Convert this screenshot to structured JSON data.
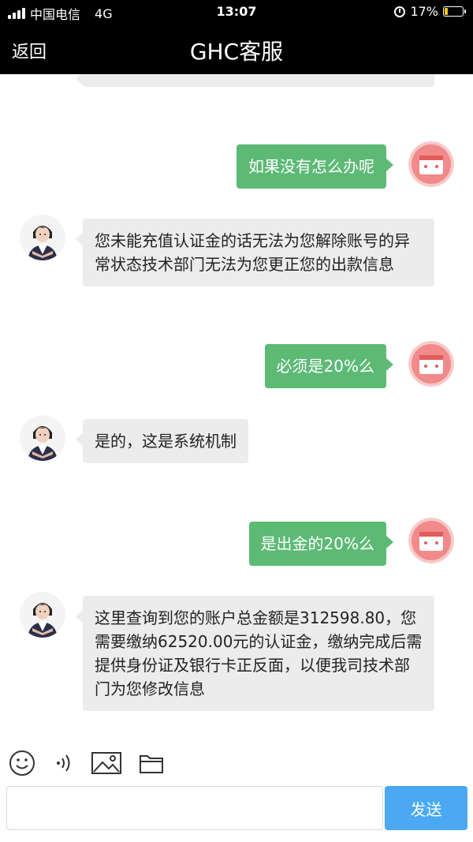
{
  "status_bar": {
    "carrier": "中国电信",
    "network": "4G",
    "time": "13:07",
    "battery": "17%",
    "battery_level": 0.17
  },
  "header": {
    "back_label": "返回",
    "title": "GHC客服"
  },
  "messages": [
    {
      "sender": "user",
      "text": "如果没有怎么办呢"
    },
    {
      "sender": "agent",
      "text": "您未能充值认证金的话无法为您解除账号的异常状态技术部门无法为您更正您的出款信息"
    },
    {
      "sender": "user",
      "text": "必须是20%么"
    },
    {
      "sender": "agent",
      "text": "是的，这是系统机制"
    },
    {
      "sender": "user",
      "text": "是出金的20%么"
    },
    {
      "sender": "agent",
      "text": "这里查询到您的账户总金额是312598.80，您需要缴纳62520.00元的认证金，缴纳完成后需提供身份证及银行卡正反面，以便我司技术部门为您修改信息"
    }
  ],
  "toolbar": {
    "icons": [
      "emoji-icon",
      "voice-icon",
      "image-icon",
      "folder-icon"
    ]
  },
  "composer": {
    "placeholder": "",
    "value": "",
    "send_label": "发送"
  },
  "colors": {
    "header_bg": "#000000",
    "incoming_bubble": "#ececec",
    "outgoing_bubble": "#5cba75",
    "send_button": "#4aa9f2",
    "user_avatar": "#f18a8a"
  }
}
